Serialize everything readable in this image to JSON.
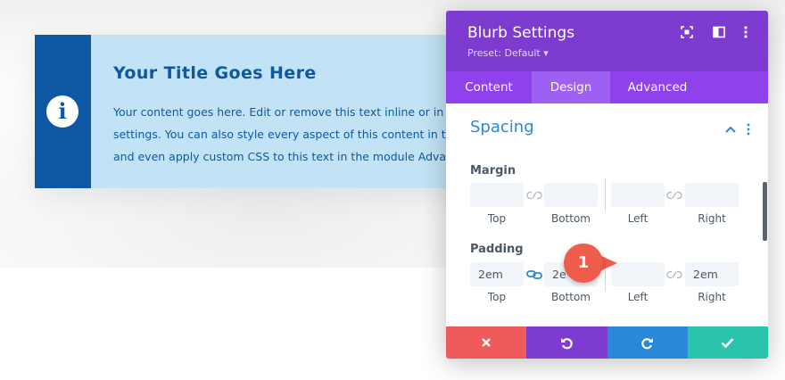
{
  "blurb": {
    "title": "Your Title Goes Here",
    "body_lines": [
      "Your content goes here. Edit or remove this text inline or in the",
      "settings. You can also style every aspect of this content in the m",
      "and even apply custom CSS to this text in the module Advanced"
    ],
    "icon": "info-icon"
  },
  "panel": {
    "title": "Blurb Settings",
    "preset": "Preset: Default ▾",
    "tabs": [
      {
        "label": "Content",
        "active": false
      },
      {
        "label": "Design",
        "active": true
      },
      {
        "label": "Advanced",
        "active": false
      }
    ],
    "section": {
      "title": "Spacing",
      "margin": {
        "label": "Margin",
        "top": "",
        "bottom": "",
        "left": "",
        "right": ""
      },
      "padding": {
        "label": "Padding",
        "top": "2em",
        "bottom": "2e",
        "left": "",
        "right": "2em"
      },
      "side_labels": {
        "top": "Top",
        "bottom": "Bottom",
        "left": "Left",
        "right": "Right"
      }
    }
  },
  "annotation": {
    "badge": "1"
  },
  "colors": {
    "header": "#7e3bd0",
    "tabs": "#8f42ec",
    "accent_blue": "#2b87da",
    "cancel": "#ef5b5b",
    "undo": "#7e3bd0",
    "redo": "#2b87da",
    "save": "#29c4a9",
    "blurb_bg": "#c2e3f6",
    "blurb_icon_bg": "#0e58a3",
    "badge": "#ef5c4b"
  }
}
